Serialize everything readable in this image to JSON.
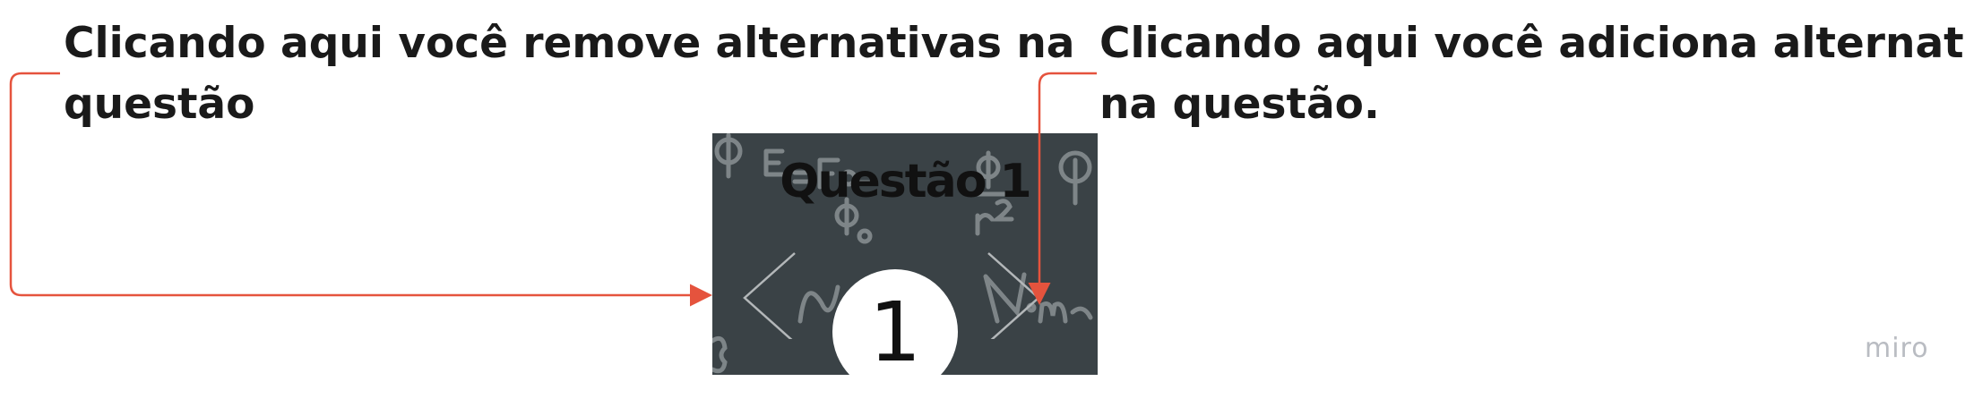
{
  "annotations": {
    "left": {
      "line1": "Clicando aqui você remove alternativas na",
      "line2": "questão"
    },
    "right": {
      "line1": "Clicando aqui você adiciona alternativas",
      "line2": "na questão."
    }
  },
  "card": {
    "title": "Questão 1",
    "counter": "1"
  },
  "watermark": "miro",
  "colors": {
    "connector": "#e5533d",
    "card_background": "#3a4246",
    "chalk": "#8a9194",
    "text": "#1a1a1a",
    "watermark": "#b9bcc2"
  },
  "icons": {
    "prev": "chevron-left-icon",
    "next": "chevron-right-icon"
  }
}
